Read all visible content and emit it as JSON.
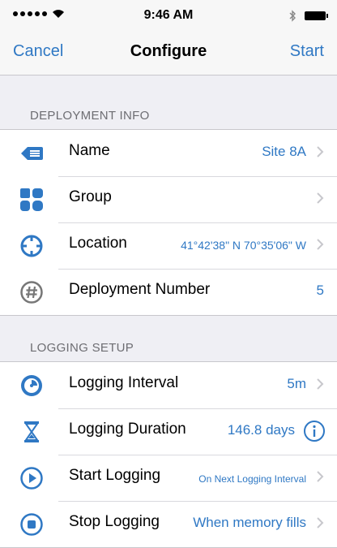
{
  "status_bar": {
    "time": "9:46 AM"
  },
  "nav": {
    "cancel": "Cancel",
    "title": "Configure",
    "start": "Start"
  },
  "sections": {
    "deployment": {
      "header": "DEPLOYMENT INFO",
      "rows": [
        {
          "label": "Name",
          "value": "Site 8A",
          "icon": "tag-icon"
        },
        {
          "label": "Group",
          "value": "",
          "icon": "group-grid-icon"
        },
        {
          "label": "Location",
          "value": "41°42'38\" N 70°35'06\" W",
          "icon": "crosshair-icon"
        },
        {
          "label": "Deployment Number",
          "value": "5",
          "icon": "hash-icon"
        }
      ]
    },
    "logging": {
      "header": "LOGGING SETUP",
      "rows": [
        {
          "label": "Logging Interval",
          "value": "5m",
          "icon": "clock-icon"
        },
        {
          "label": "Logging Duration",
          "value": "146.8 days",
          "icon": "hourglass-icon"
        },
        {
          "label": "Start Logging",
          "value": "On Next Logging Interval",
          "icon": "play-icon"
        },
        {
          "label": "Stop Logging",
          "value": "When memory fills",
          "icon": "stop-icon"
        }
      ]
    }
  },
  "colors": {
    "accent": "#2f78c4",
    "background": "#efeff4",
    "header_text": "#6d6d72"
  }
}
